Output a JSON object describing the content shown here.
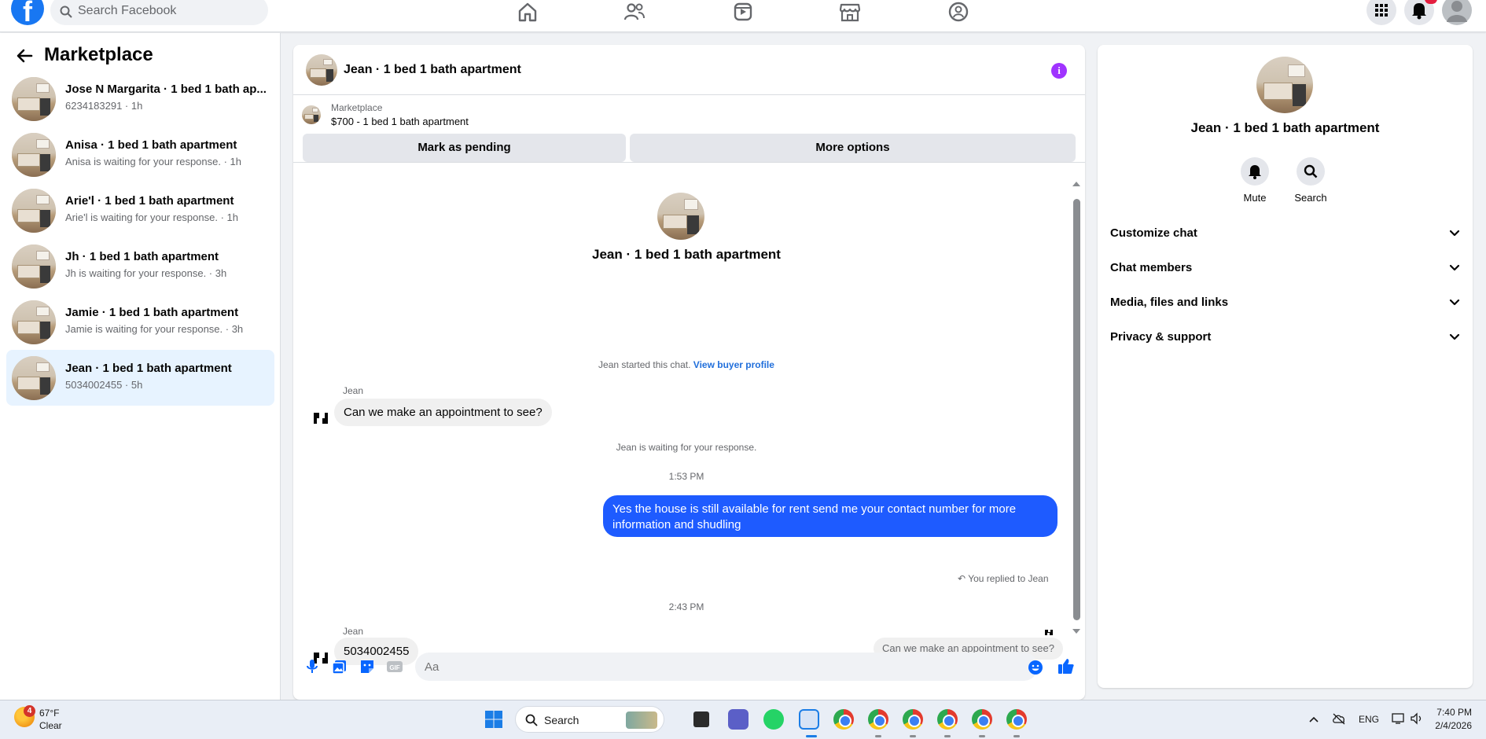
{
  "topbar": {
    "search_placeholder": "Search Facebook",
    "nav_icons": [
      "home-icon",
      "friends-icon",
      "video-icon",
      "marketplace-icon",
      "groups-icon"
    ],
    "right_icons": [
      "menu-grid-icon",
      "notification-bell-icon",
      "account-avatar"
    ],
    "notification_count": "1",
    "brand_color": "#1877f2"
  },
  "sidebar": {
    "title": "Marketplace",
    "conversations": [
      {
        "name": "Jose N Margarita · 1 bed 1 bath ap...",
        "sub": "6234183291 · 1h"
      },
      {
        "name": "Anisa · 1 bed 1 bath apartment",
        "sub": "Anisa is waiting for your response. · 1h"
      },
      {
        "name": "Arie'l · 1 bed 1 bath apartment",
        "sub": "Arie'l is waiting for your response. · 1h"
      },
      {
        "name": "Jh · 1 bed 1 bath apartment",
        "sub": "Jh is waiting for your response. · 3h"
      },
      {
        "name": "Jamie · 1 bed 1 bath apartment",
        "sub": "Jamie is waiting for your response. · 3h"
      },
      {
        "name": "Jean · 1 bed 1 bath apartment",
        "sub": "5034002455 · 5h",
        "selected": true
      }
    ]
  },
  "chat": {
    "title": "Jean · 1 bed 1 bath apartment",
    "marketplace_label": "Marketplace",
    "listing": "$700 - 1 bed 1 bath apartment",
    "mark_pending": "Mark as pending",
    "more_options": "More options",
    "profile_name": "Jean · 1 bed 1 bath apartment",
    "started_text": "Jean started this chat.",
    "view_buyer_profile": "View buyer profile",
    "sender1": "Jean",
    "msg1": "Can we make an appointment to see?",
    "waiting": "Jean is waiting for your response.",
    "time1": "1:53 PM",
    "replied_to": "You replied to Jean",
    "quoted": "Can we make an appointment to see?",
    "outgoing": "Yes the house is still available for rent send me your contact number for more information and shudling",
    "time2": "2:43 PM",
    "sender2": "Jean",
    "msg2": "5034002455",
    "composer_placeholder": "Aa",
    "accent_color": "#1e5bff"
  },
  "details": {
    "name": "Jean · 1 bed 1 bath apartment",
    "mute": "Mute",
    "search": "Search",
    "sections": [
      "Customize chat",
      "Chat members",
      "Media, files and links",
      "Privacy & support"
    ]
  },
  "taskbar": {
    "weather_badge": "4",
    "temperature": "67°F",
    "condition": "Clear",
    "search": "Search",
    "language": "ENG",
    "time": "7:40 PM",
    "date": "2/4/2026"
  }
}
